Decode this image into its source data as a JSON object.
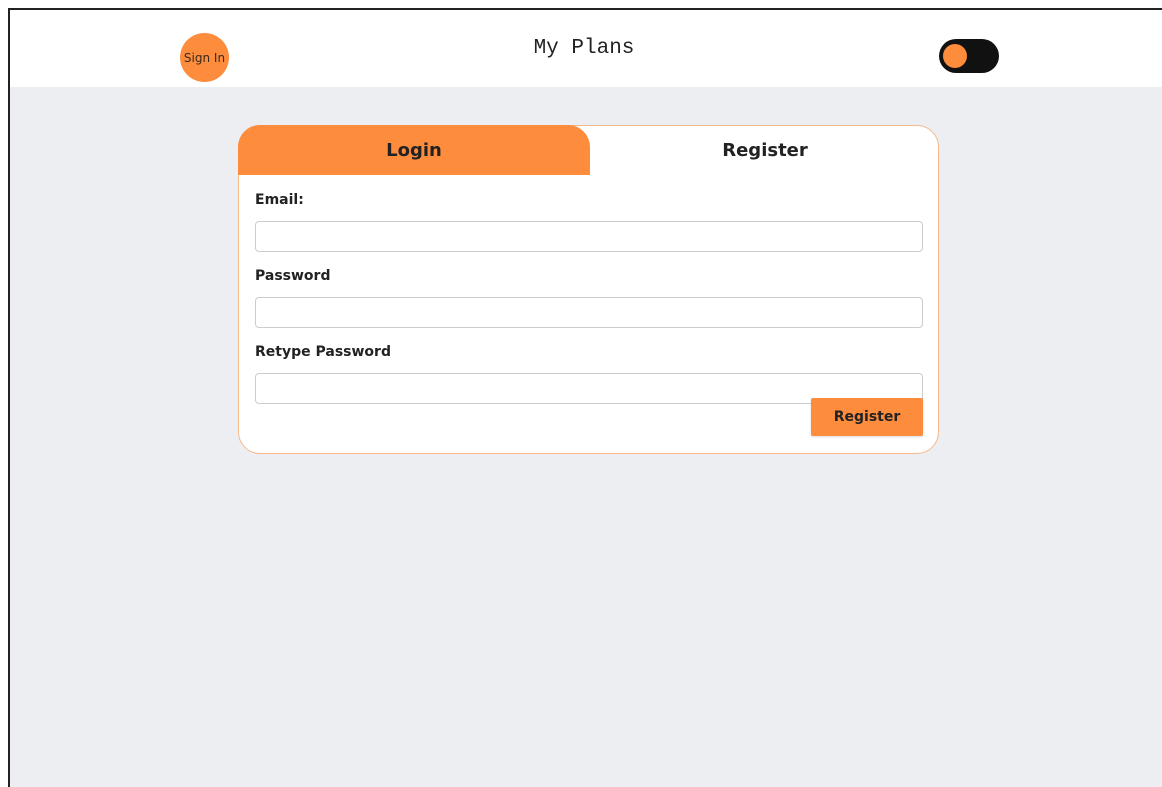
{
  "header": {
    "signin_label": "Sign In",
    "title": "My Plans",
    "theme_toggle": {
      "state": "on",
      "icon": "toggle-switch"
    }
  },
  "auth": {
    "tabs": [
      {
        "label": "Login",
        "active": false
      },
      {
        "label": "Register",
        "active": true
      }
    ],
    "fields": [
      {
        "label": "Email:",
        "value": "",
        "placeholder": ""
      },
      {
        "label": "Password",
        "value": "",
        "placeholder": ""
      },
      {
        "label": "Retype Password",
        "value": "",
        "placeholder": ""
      }
    ],
    "submit_label": "Register"
  },
  "colors": {
    "accent": "#fd8c3d",
    "background": "#eceef1",
    "card_border": "#f5b98a"
  }
}
